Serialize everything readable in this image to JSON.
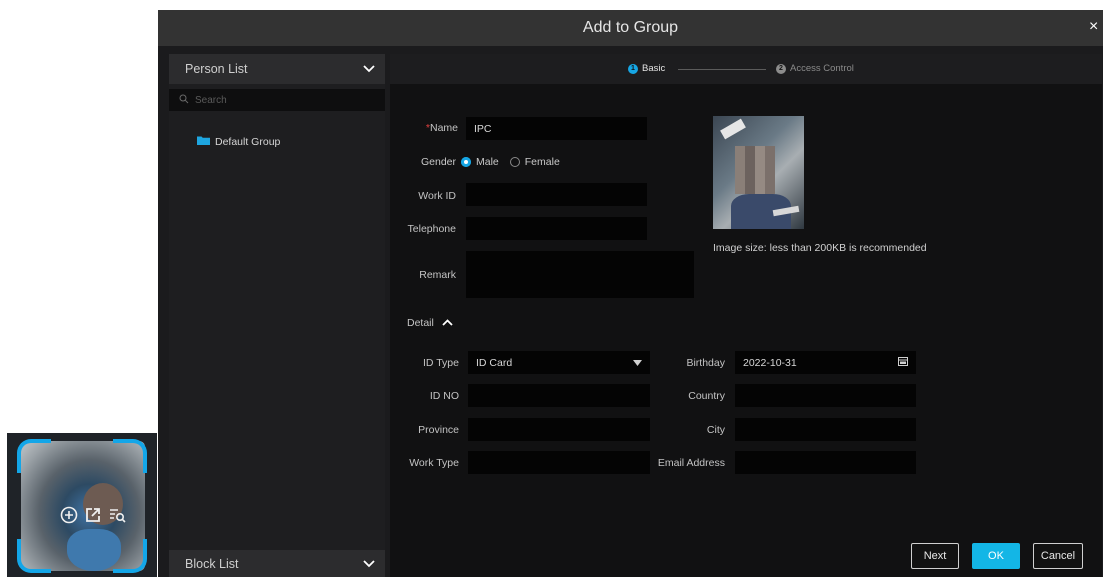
{
  "dialog": {
    "title": "Add to Group",
    "close_glyph": "×"
  },
  "left_panel": {
    "person_list_label": "Person List",
    "search_placeholder": "Search",
    "groups": [
      "Default Group"
    ],
    "block_list_label": "Block List"
  },
  "stepper": {
    "steps": [
      {
        "number": "1",
        "label": "Basic",
        "active": true
      },
      {
        "number": "2",
        "label": "Access Control",
        "active": false
      }
    ]
  },
  "form": {
    "name_required_mark": "*",
    "name_label": "Name",
    "name_value": "IPC",
    "gender_label": "Gender",
    "gender_options": [
      "Male",
      "Female"
    ],
    "gender_selected": "Male",
    "work_id_label": "Work ID",
    "work_id_value": "",
    "telephone_label": "Telephone",
    "telephone_value": "",
    "remark_label": "Remark",
    "remark_value": "",
    "image_hint": "Image size: less than 200KB is recommended"
  },
  "detail": {
    "toggle_label": "Detail",
    "id_type_label": "ID Type",
    "id_type_value": "ID Card",
    "id_no_label": "ID NO",
    "id_no_value": "",
    "province_label": "Province",
    "province_value": "",
    "work_type_label": "Work Type",
    "work_type_value": "",
    "birthday_label": "Birthday",
    "birthday_value": "2022-10-31",
    "country_label": "Country",
    "country_value": "",
    "city_label": "City",
    "city_value": "",
    "email_label": "Email Address",
    "email_value": ""
  },
  "buttons": {
    "next": "Next",
    "ok": "OK",
    "cancel": "Cancel"
  },
  "colors": {
    "accent": "#13b6e6",
    "dialog_bg": "#1b1b1d",
    "titlebar_bg": "#333333",
    "required": "#e04040"
  },
  "icons": {
    "thumb_actions": [
      "add-circle-icon",
      "open-external-icon",
      "search-list-icon"
    ],
    "folder": "folder-icon",
    "calendar": "calendar-icon"
  }
}
